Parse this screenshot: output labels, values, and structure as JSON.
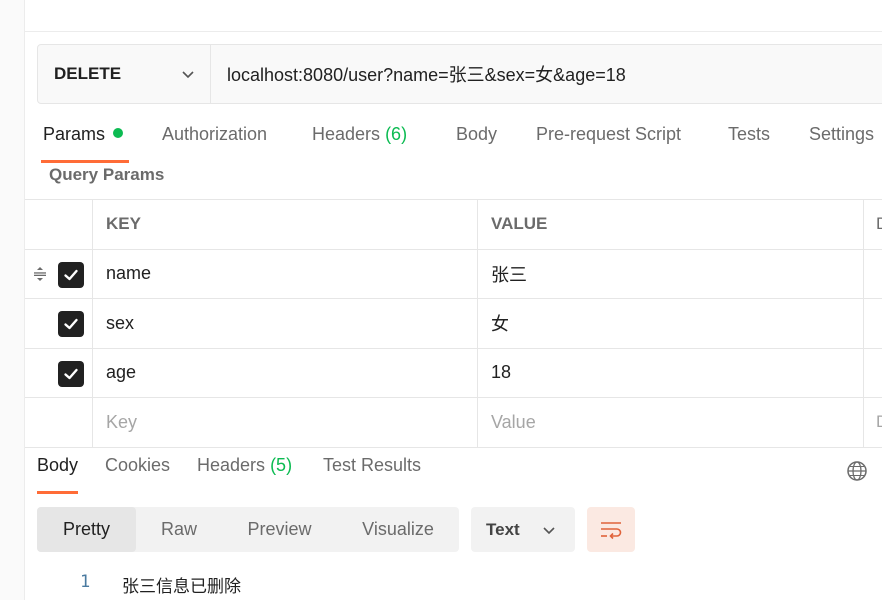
{
  "request": {
    "method": "DELETE",
    "url": "localhost:8080/user?name=张三&sex=女&age=18"
  },
  "request_tabs": [
    {
      "label": "Params",
      "active": true,
      "has_dot": true
    },
    {
      "label": "Authorization"
    },
    {
      "label": "Headers",
      "count": "(6)"
    },
    {
      "label": "Body"
    },
    {
      "label": "Pre-request Script"
    },
    {
      "label": "Tests"
    },
    {
      "label": "Settings"
    }
  ],
  "query_params": {
    "title": "Query Params",
    "headers": {
      "key": "KEY",
      "value": "VALUE",
      "description": "D"
    },
    "rows": [
      {
        "key": "name",
        "value": "张三",
        "checked": true
      },
      {
        "key": "sex",
        "value": "女",
        "checked": true
      },
      {
        "key": "age",
        "value": "18",
        "checked": true
      }
    ],
    "placeholder": {
      "key": "Key",
      "value": "Value",
      "description": "D"
    }
  },
  "response_tabs": [
    {
      "label": "Body",
      "active": true
    },
    {
      "label": "Cookies"
    },
    {
      "label": "Headers",
      "count": "(5)"
    },
    {
      "label": "Test Results"
    }
  ],
  "view_modes": [
    {
      "label": "Pretty",
      "active": true
    },
    {
      "label": "Raw"
    },
    {
      "label": "Preview"
    },
    {
      "label": "Visualize"
    }
  ],
  "format": "Text",
  "response_body": [
    {
      "line": "1",
      "text": "张三信息已删除"
    }
  ],
  "icons": {
    "method_dropdown": "chevron-down-icon",
    "drag_handle": "drag-handle-icon",
    "checkbox": "checkmark-icon",
    "network": "globe-icon",
    "format_dropdown": "chevron-down-icon",
    "wrap": "wrap-lines-icon"
  },
  "colors": {
    "accent": "#ff6c37",
    "success": "#0cbb52",
    "checkbox": "#212121",
    "line_number": "#4a7aa0"
  }
}
